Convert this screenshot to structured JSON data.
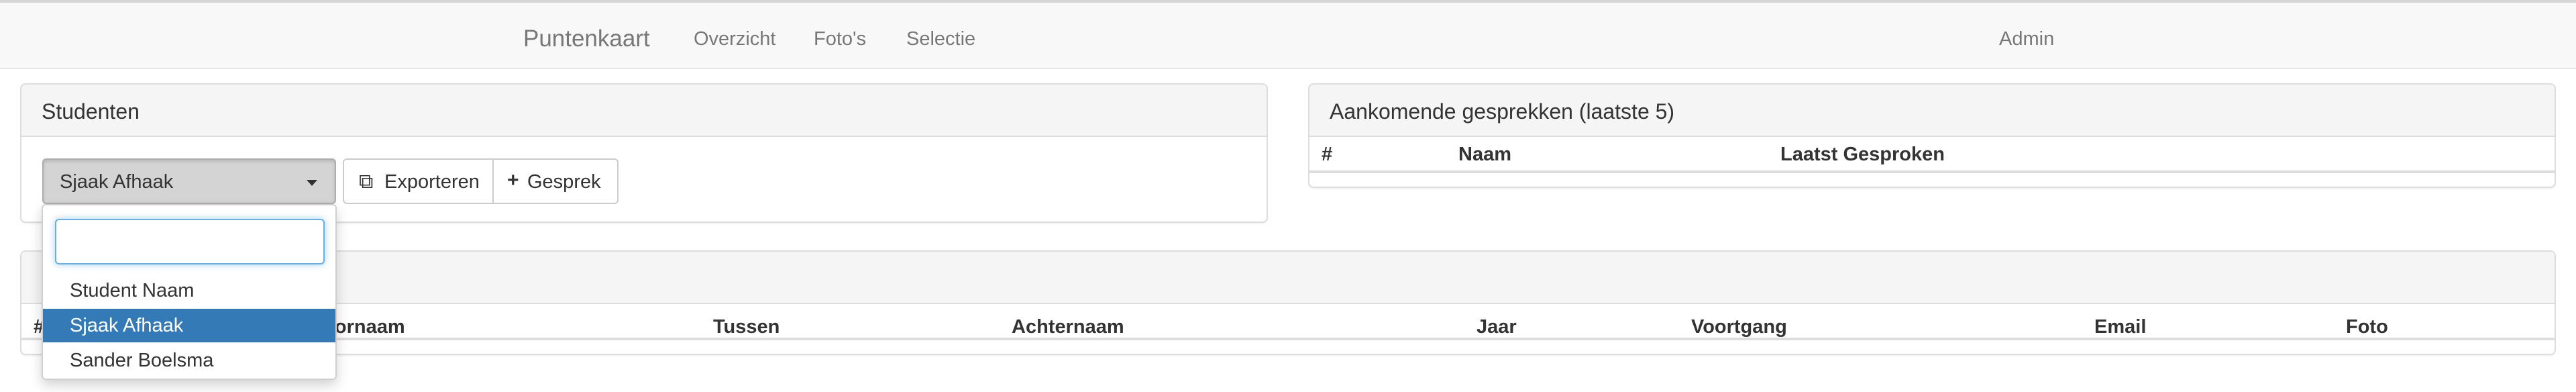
{
  "navbar": {
    "brand": "Puntenkaart",
    "links": [
      "Overzicht",
      "Foto's",
      "Selectie"
    ],
    "user": "Admin"
  },
  "studenten_panel": {
    "title": "Studenten",
    "selected_student": "Sjaak Afhaak",
    "export_label": "Exporteren",
    "gesprek_label": "Gesprek",
    "export_icon": "copy-icon",
    "gesprek_icon": "plus-icon"
  },
  "dropdown": {
    "search_value": "",
    "options": [
      "Student Naam",
      "Sjaak Afhaak",
      "Sander Boelsma"
    ],
    "selected_index": 1,
    "highlight_color": "#337ab7"
  },
  "gesprekken_panel": {
    "title": "Aankomende gesprekken (laatste 5)",
    "columns": [
      "#",
      "Naam",
      "Laatst Gesproken"
    ]
  },
  "students_table": {
    "columns": [
      "#",
      "Voornaam",
      "Tussen",
      "Achternaam",
      "Jaar",
      "Voortgang",
      "Email",
      "Foto"
    ]
  }
}
